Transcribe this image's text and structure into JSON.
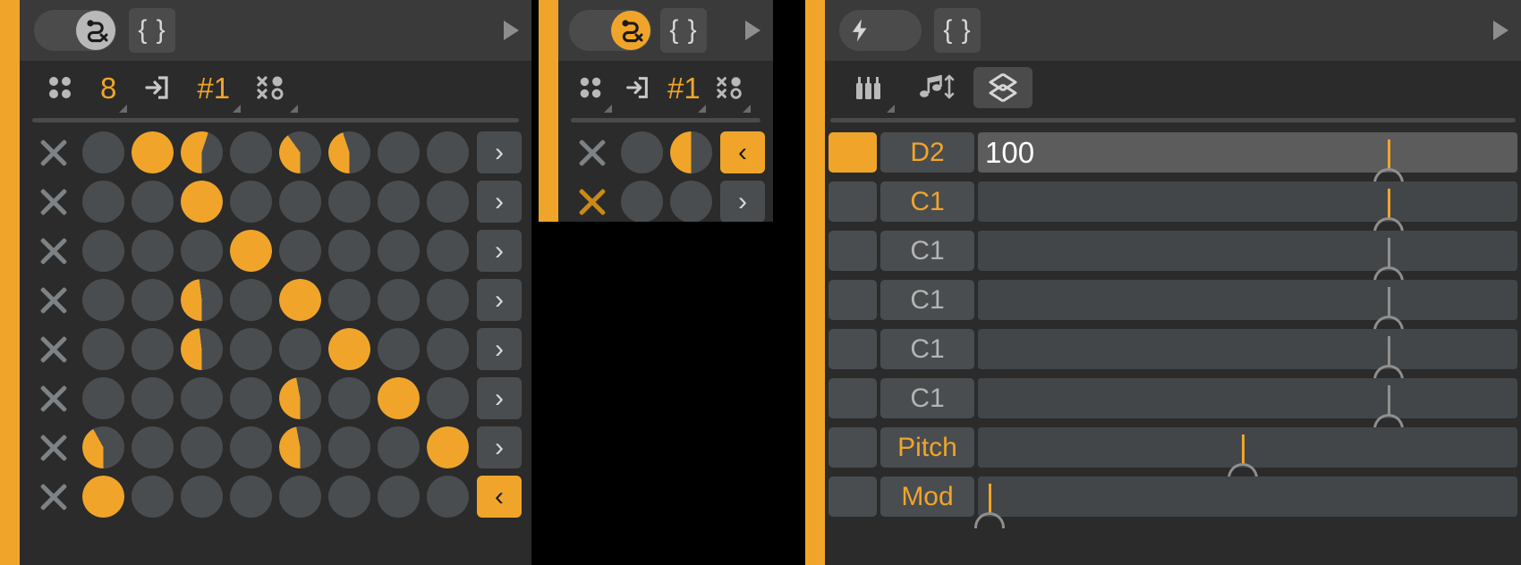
{
  "panels": {
    "sequencer": {
      "title_toggle": {
        "icon": "path-off-icon",
        "state": "off",
        "knob_color": "#b9b9b9"
      },
      "braces_label": "{ }",
      "play_icon": "play-arrow-icon",
      "toolbar": [
        {
          "icon": "four-dots-icon",
          "label": ""
        },
        {
          "icon": "",
          "label": "8"
        },
        {
          "icon": "step-in-icon",
          "label": ""
        },
        {
          "icon": "",
          "label": "#1"
        },
        {
          "icon": "random-dots-icon",
          "label": ""
        }
      ],
      "rows": [
        {
          "x_icon": "close-icon",
          "x_active": false,
          "cells": [
            0,
            100,
            55,
            0,
            40,
            45,
            0,
            0
          ],
          "arrow": ">",
          "arrow_active": false
        },
        {
          "x_icon": "close-icon",
          "x_active": false,
          "cells": [
            0,
            0,
            100,
            0,
            0,
            0,
            0,
            0
          ],
          "arrow": ">",
          "arrow_active": false
        },
        {
          "x_icon": "close-icon",
          "x_active": false,
          "cells": [
            0,
            0,
            0,
            100,
            0,
            0,
            0,
            0
          ],
          "arrow": ">",
          "arrow_active": false
        },
        {
          "x_icon": "close-icon",
          "x_active": false,
          "cells": [
            0,
            0,
            48,
            0,
            100,
            0,
            0,
            0
          ],
          "arrow": ">",
          "arrow_active": false
        },
        {
          "x_icon": "close-icon",
          "x_active": false,
          "cells": [
            0,
            0,
            48,
            0,
            0,
            100,
            0,
            0
          ],
          "arrow": ">",
          "arrow_active": false
        },
        {
          "x_icon": "close-icon",
          "x_active": false,
          "cells": [
            0,
            0,
            0,
            0,
            47,
            0,
            100,
            0
          ],
          "arrow": ">",
          "arrow_active": false
        },
        {
          "x_icon": "close-icon",
          "x_active": false,
          "cells": [
            42,
            0,
            0,
            0,
            47,
            0,
            0,
            100
          ],
          "arrow": ">",
          "arrow_active": false
        },
        {
          "x_icon": "close-icon",
          "x_active": false,
          "cells": [
            100,
            0,
            0,
            0,
            0,
            0,
            0,
            0
          ],
          "arrow": "<",
          "arrow_active": true
        }
      ]
    },
    "mini_sequencer": {
      "title_toggle": {
        "icon": "path-off-icon",
        "state": "on",
        "knob_color": "#f0a52a"
      },
      "braces_label": "{ }",
      "play_icon": "play-arrow-icon",
      "toolbar": [
        {
          "icon": "four-dots-icon",
          "label": ""
        },
        {
          "icon": "step-in-icon",
          "label": ""
        },
        {
          "icon": "",
          "label": "#1"
        },
        {
          "icon": "random-dots-icon",
          "label": ""
        }
      ],
      "rows": [
        {
          "x_icon": "close-icon",
          "x_active": false,
          "cells": [
            0,
            50
          ],
          "arrow": "<",
          "arrow_active": true
        },
        {
          "x_icon": "close-icon",
          "x_active": true,
          "cells": [
            0,
            0
          ],
          "arrow": ">",
          "arrow_active": false
        }
      ]
    },
    "note_editor": {
      "title_toggle": {
        "icon": "lightning-bolt-icon",
        "state": "off",
        "knob_color": "#4b4b4b"
      },
      "braces_label": "{ }",
      "play_icon": "play-arrow-icon",
      "toolbar": [
        {
          "icon": "piano-keys-icon",
          "label": "",
          "selected": false
        },
        {
          "icon": "note-updown-icon",
          "label": "",
          "selected": false
        },
        {
          "icon": "diamond-updown-icon",
          "label": "",
          "selected": true
        }
      ],
      "rows": [
        {
          "swatch_on": true,
          "label": "D2",
          "label_muted": false,
          "value": "100",
          "lit": true,
          "handle_pct": 76,
          "handle_lit": true
        },
        {
          "swatch_on": false,
          "label": "C1",
          "label_muted": false,
          "value": "",
          "lit": false,
          "handle_pct": 76,
          "handle_lit": true
        },
        {
          "swatch_on": false,
          "label": "C1",
          "label_muted": true,
          "value": "",
          "lit": false,
          "handle_pct": 76,
          "handle_lit": false
        },
        {
          "swatch_on": false,
          "label": "C1",
          "label_muted": true,
          "value": "",
          "lit": false,
          "handle_pct": 76,
          "handle_lit": false
        },
        {
          "swatch_on": false,
          "label": "C1",
          "label_muted": true,
          "value": "",
          "lit": false,
          "handle_pct": 76,
          "handle_lit": false
        },
        {
          "swatch_on": false,
          "label": "C1",
          "label_muted": true,
          "value": "",
          "lit": false,
          "handle_pct": 76,
          "handle_lit": false
        },
        {
          "swatch_on": false,
          "label": "Pitch",
          "label_muted": false,
          "value": "",
          "lit": false,
          "handle_pct": 49,
          "handle_lit": true
        },
        {
          "swatch_on": false,
          "label": "Mod",
          "label_muted": false,
          "value": "",
          "lit": false,
          "handle_pct": 2,
          "handle_lit": true
        }
      ]
    }
  },
  "colors": {
    "accent": "#f0a52a",
    "panel_bg": "#2b2b2b",
    "title_bg": "#3a3a3a",
    "cell_off": "#4a4d4f",
    "text_dim": "#b4b4b4"
  }
}
